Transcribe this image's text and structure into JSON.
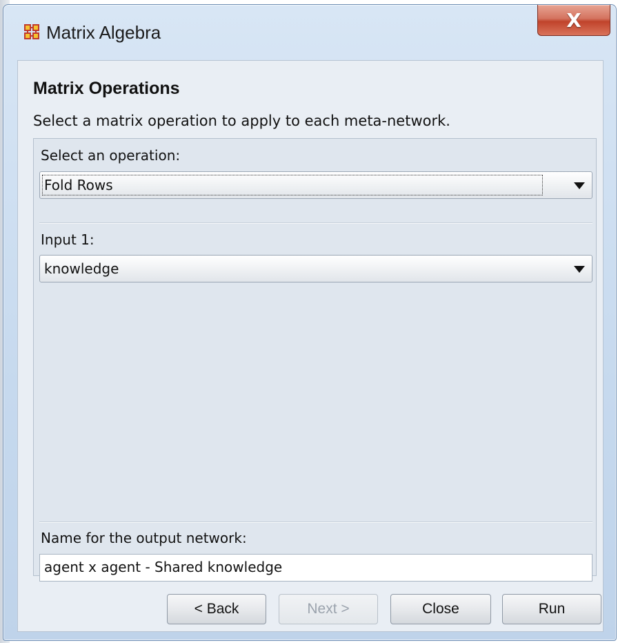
{
  "window": {
    "title": "Matrix Algebra",
    "close_glyph": "X"
  },
  "header": {
    "title": "Matrix Operations",
    "description": "Select a matrix operation to apply to each meta-network."
  },
  "form": {
    "operation_label": "Select an operation:",
    "operation_value": "Fold Rows",
    "input1_label": "Input 1:",
    "input1_value": "knowledge",
    "output_label": "Name for the output network:",
    "output_value": "agent x agent - Shared knowledge"
  },
  "buttons": {
    "back": "< Back",
    "next": "Next >",
    "close": "Close",
    "run": "Run"
  },
  "icons": {
    "app": "grid-network-icon",
    "close": "close-icon",
    "dropdown": "chevron-down-icon"
  }
}
